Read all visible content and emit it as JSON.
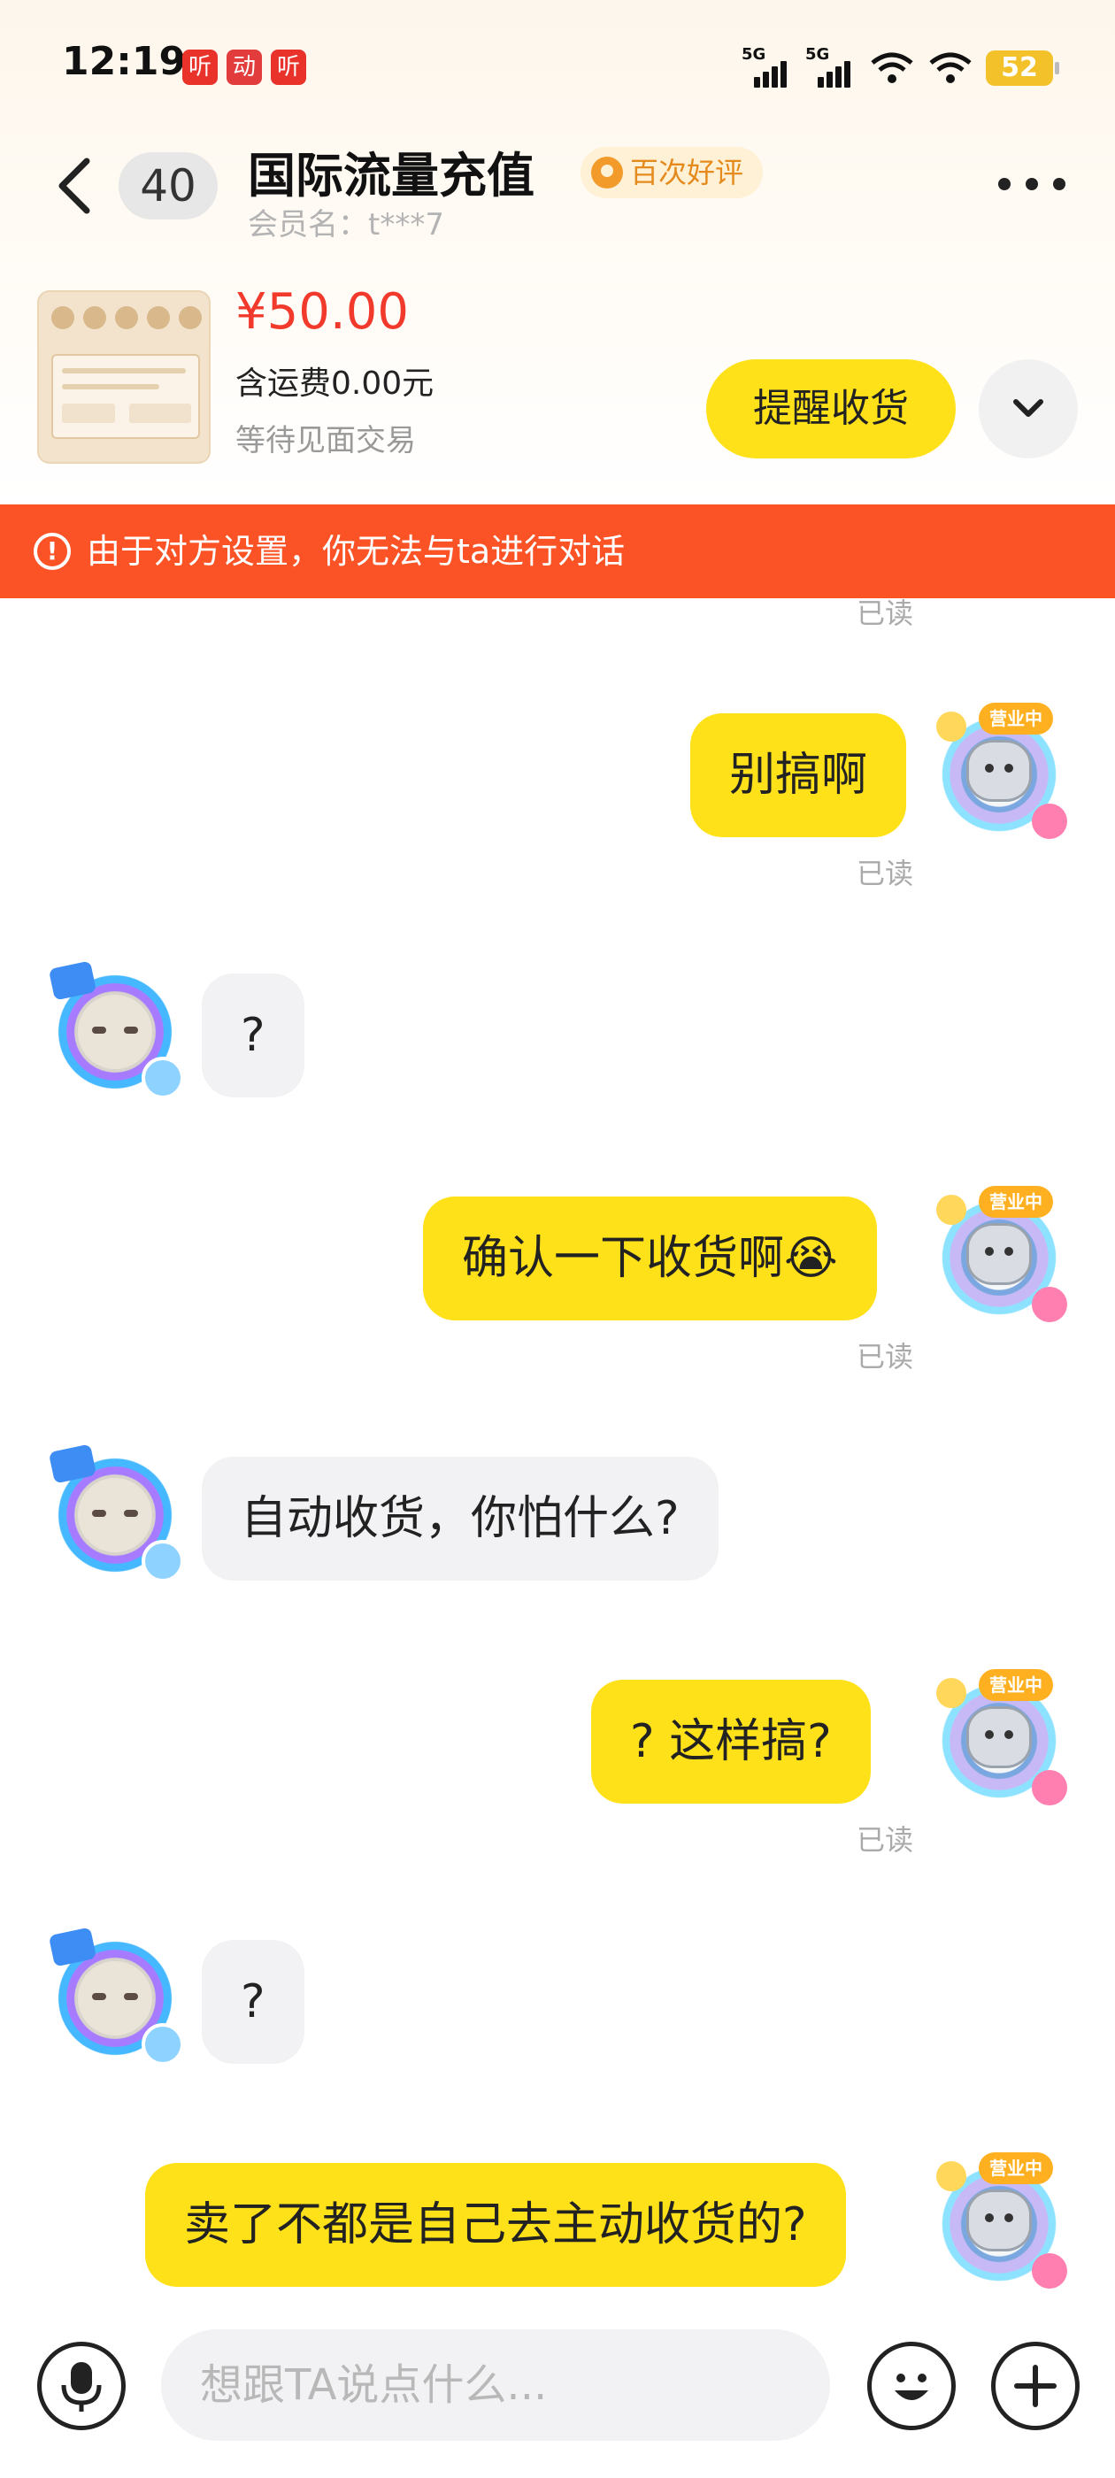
{
  "status_bar": {
    "time": "12:19",
    "app_badges": [
      "听",
      "动",
      "听"
    ],
    "network_labels": [
      "5G",
      "5G"
    ],
    "battery": "52"
  },
  "header": {
    "unread_count": "40",
    "title": "国际流量充值",
    "rating_badge": "百次好评",
    "member_name": "会员名：t***7"
  },
  "order": {
    "price": "¥50.00",
    "shipping": "含运费0.00元",
    "status": "等待见面交易",
    "remind_button": "提醒收货"
  },
  "banner": {
    "icon": "!",
    "text": "由于对方设置，你无法与ta进行对话"
  },
  "avatar_me_tag": "营业中",
  "messages": [
    {
      "sender": "me",
      "text": "别搞啊",
      "read": "已读"
    },
    {
      "sender": "them",
      "text": "?"
    },
    {
      "sender": "me",
      "text": "确认一下收货啊😭",
      "read": "已读"
    },
    {
      "sender": "them",
      "text": "自动收货，你怕什么?"
    },
    {
      "sender": "me",
      "text": "? 这样搞?",
      "read": "已读"
    },
    {
      "sender": "them",
      "text": "?"
    },
    {
      "sender": "me",
      "text": "卖了不都是自己去主动收货的?"
    }
  ],
  "top_read": "已读",
  "input": {
    "placeholder": "想跟TA说点什么..."
  },
  "colors": {
    "accent_yellow": "#ffe11a",
    "price_red": "#f23a2c",
    "banner_orange": "#fc5326"
  }
}
